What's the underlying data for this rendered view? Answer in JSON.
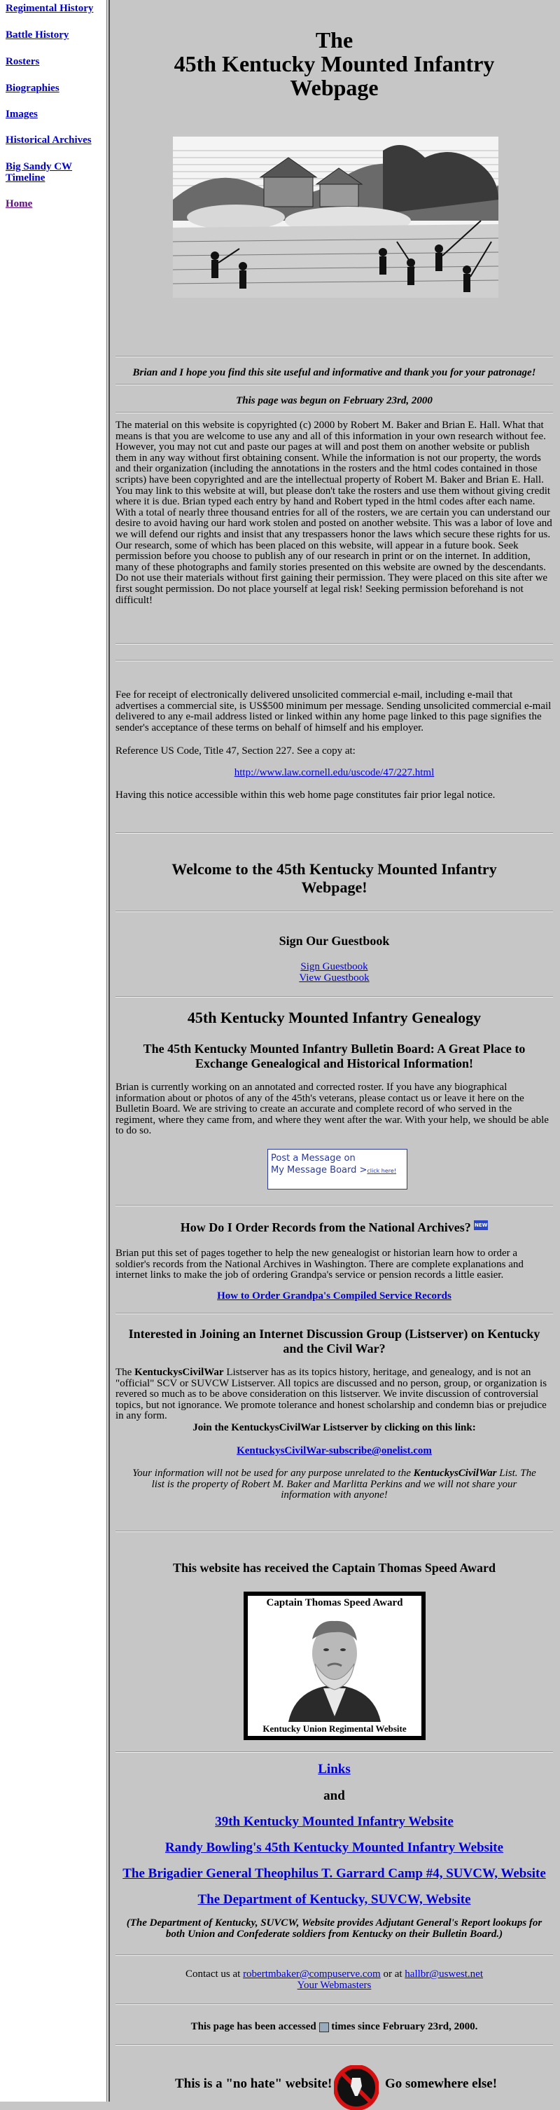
{
  "nav": [
    {
      "label": "Regimental History",
      "visited": false
    },
    {
      "label": "Battle History",
      "visited": false
    },
    {
      "label": "Rosters",
      "visited": false
    },
    {
      "label": "Biographies",
      "visited": false
    },
    {
      "label": "Images",
      "visited": false
    },
    {
      "label": "Historical Archives",
      "visited": false
    },
    {
      "label": "Big Sandy CW Timeline",
      "visited": false
    },
    {
      "label": "Home",
      "visited": true
    }
  ],
  "header": {
    "title_line1": "The",
    "title_line2": "45th Kentucky Mounted Infantry",
    "title_line3": "Webpage"
  },
  "intro": {
    "thanks": "Brian and I hope you find this site useful and informative and thank you for your patronage!",
    "begun": "This page was begun on February 23rd, 2000",
    "copyright": "The material on this website is copyrighted (c) 2000 by Robert M. Baker and Brian E. Hall. What that means is that you are welcome to use any and all of this information in your own research without fee. However, you may not cut and paste our pages at will and post them on another website or publish them in any way without first obtaining consent. While the information is not our property, the words and their organization (including the annotations in the rosters and the html codes contained in those scripts) have been copyrighted and are the intellectual property of Robert M. Baker and Brian E. Hall. You may link to this website at will, but please don't take the rosters and use them without giving credit where it is due. Brian typed each entry by hand and Robert typed in the html codes after each name. With a total of nearly three thousand entries for all of the rosters, we are certain you can understand our desire to avoid having our hard work stolen and posted on another website. This was a labor of love and we will defend our rights and insist that any trespassers honor the laws which secure these rights for us. Our research, some of which has been placed on this website, will appear in a future book. Seek permission before you choose to publish any of our research in print or on the internet. In addition, many of these photographs and family stories presented on this website are owned by the descendants. Do not use their materials without first gaining their permission. They were placed on this site after we first sought permission. Do not place yourself at legal risk! Seeking permission beforehand is not difficult!"
  },
  "email_notice": {
    "fee": "Fee for receipt of electronically delivered unsolicited commercial e-mail, including e-mail that advertises a commercial site, is US$500 minimum per message. Sending unsolicited commercial e-mail delivered to any e-mail address listed or linked within any home page linked to this page signifies the sender's acceptance of these terms on behalf of himself and his employer.",
    "reference": "Reference US Code, Title 47, Section 227. See a copy at:",
    "url": "http://www.law.cornell.edu/uscode/47/227.html",
    "notice": "Having this notice accessible within this web home page constitutes fair prior legal notice."
  },
  "welcome": "Welcome to the 45th Kentucky Mounted Infantry Webpage!",
  "guestbook": {
    "heading": "Sign Our Guestbook",
    "sign": "Sign Guestbook",
    "view": "View Guestbook"
  },
  "genealogy": {
    "heading": "45th Kentucky Mounted Infantry Genealogy",
    "subheading": "The 45th Kentucky Mounted Infantry Bulletin Board: A Great Place to Exchange Genealogical and Historical Information!",
    "text": "Brian is currently working on an annotated and corrected roster. If you have any biographical information about or photos of any of the 45th's veterans, please contact us or leave it here on the Bulletin Board. We are striving to create an accurate and complete record of who served in the regiment, where they came from, and where they went after the war. With your help, we should be able to do so.",
    "msg_line1": "Post a Message on",
    "msg_line2": "My Message Board >",
    "msg_click": "click here!"
  },
  "records": {
    "heading": "How Do I Order Records from the National Archives?",
    "badge": "NEW",
    "text": "Brian put this set of pages together to help the new genealogist or historian learn how to order a soldier's records from the National Archives in Washington. There are complete explanations and internet links to make the job of ordering Grandpa's service or pension records a little easier.",
    "link": "How to Order Grandpa's Compiled Service Records"
  },
  "listserv": {
    "heading": "Interested in Joining an Internet Discussion Group (Listserver) on Kentucky and the Civil War?",
    "text_prefix": "The ",
    "name": "KentuckysCivilWar",
    "text": " Listserver has as its topics history, heritage, and genealogy, and is not an \"official\" SCV or SUVCW Listserver. All topics are discussed and no person, group, or organization is revered so much as to be above consideration on this listserver. We invite discussion of controversial topics, but not ignorance. We promote tolerance and honest scholarship and condemn bias or prejudice in any form.",
    "join": "Join the KentuckysCivilWar Listserver by clicking on this link:",
    "link": "KentuckysCivilWar-subscribe@onelist.com",
    "privacy_1": "Your information will not be used for any purpose unrelated to the ",
    "privacy_name": "KentuckysCivilWar",
    "privacy_2": " List. The list is the property of Robert M. Baker and Marlitta Perkins and we will not share your information with anyone!"
  },
  "award": {
    "heading": "This website has received the Captain Thomas Speed Award",
    "top": "Captain Thomas Speed Award",
    "bottom": "Kentucky Union Regimental Website"
  },
  "links": {
    "heading": "Links",
    "and": "and",
    "items": [
      "39th Kentucky Mounted Infantry Website",
      "Randy Bowling's 45th Kentucky Mounted Infantry Website",
      "The Brigadier General Theophilus T. Garrard Camp #4, SUVCW, Website",
      "The Department of Kentucky, SUVCW, Website"
    ],
    "note": "(The Department of Kentucky, SUVCW, Website provides Adjutant General's Report lookups for both Union and Confederate soldiers from Kentucky on their Bulletin Board.)"
  },
  "contact": {
    "prefix": "Contact us at ",
    "email1": "robertmbaker@compuserve.com",
    "or": " or at ",
    "email2": "hallbr@uswest.net",
    "webmasters": "Your Webmasters"
  },
  "counter": {
    "prefix": "This page has been accessed ",
    "suffix": " times since February 23rd, 2000."
  },
  "footer": {
    "left": "This is a \"no hate\" website!",
    "right": "Go somewhere else!"
  },
  "colors": {
    "background": "#c6c6c6",
    "link": "#0000d4",
    "visited": "#5a0f78",
    "msgbox": "#2a3aa0"
  }
}
